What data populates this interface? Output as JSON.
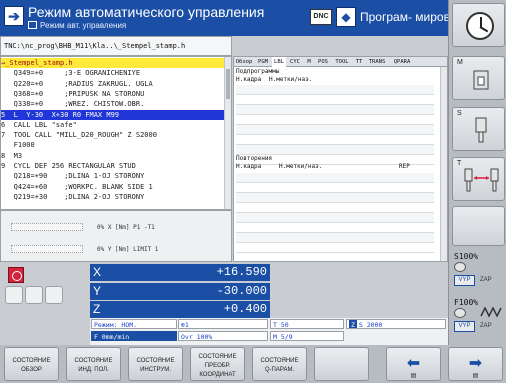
{
  "header": {
    "mode_icon": "machine-mode-icon",
    "mode_title": "Режим автоматического управления",
    "mode_sub": "Режим авт. управления",
    "dnc": "DNC",
    "prog_title": "Програм- мирован…"
  },
  "program": {
    "path": "TNC:\\nc_prog\\BHB_M11\\Kla..\\_Stempel_stamp.h",
    "lines": [
      {
        "text": "→_Stempel_stamp.h",
        "style": "cur"
      },
      {
        "text": "   Q349=+0     ;3-E OGRANICHENIYE",
        "style": ""
      },
      {
        "text": "   Q220=+0     ;RADIUS ZAKRUGL. UGLA",
        "style": ""
      },
      {
        "text": "   Q368=+0     ;PRIPUSK NA STORONU",
        "style": ""
      },
      {
        "text": "   Q338=+0     ;WREZ. CHISTOW.OBR.",
        "style": ""
      },
      {
        "text": "5  L  Y-30  X+30 R0 FMAX M99",
        "style": "sel"
      },
      {
        "text": "6  CALL LBL \"safe\"",
        "style": ""
      },
      {
        "text": "7  TOOL CALL \"MILL_D20_ROUGH\" Z S2000",
        "style": ""
      },
      {
        "text": "   F1000",
        "style": ""
      },
      {
        "text": "8  M3",
        "style": ""
      },
      {
        "text": "9  CYCL DEF 256 RECTANGULAR STUD",
        "style": ""
      },
      {
        "text": "   Q218=+90    ;DLINA 1-OJ STORONY",
        "style": ""
      },
      {
        "text": "   Q424=+60    ;WORKPC. BLANK SIDE 1",
        "style": ""
      },
      {
        "text": "   Q219=+30    ;DLINA 2-OJ STORONY",
        "style": ""
      }
    ]
  },
  "status_small": {
    "row1": "0% X [Nm]  P1  -T1",
    "row2": "0% Y [Nm]  LIMIT 1"
  },
  "tabs": {
    "items": [
      "Обзор",
      "PGM",
      "LBL",
      "CYC",
      "M",
      "POS",
      "TOOL",
      "TT",
      "TRANS",
      "QPARA"
    ],
    "active": "LBL",
    "sub_title": "Подпрограммы",
    "sub_cols": [
      "Н.кадра",
      "Н.метки/наз."
    ],
    "rep_title": "Повторения",
    "rep_cols": [
      "Н.кадра",
      "Н.метки/наз.",
      "REP"
    ]
  },
  "position": {
    "axes": [
      {
        "axis": "X",
        "value": "+16.590"
      },
      {
        "axis": "Y",
        "value": "-30.000"
      },
      {
        "axis": "Z",
        "value": "+0.400"
      }
    ],
    "mode": "Режим: НОМ.",
    "feed": "F 0mm/min",
    "spindle_ref": "1",
    "ovr": "Ovr 100%",
    "tool": "T 50",
    "speed": "S 2000",
    "mfunc": "M 5/9",
    "z_tag": "Z"
  },
  "right_keys": {
    "m": "M",
    "s": "S",
    "t": "T",
    "s_ovr": "S100%",
    "f_ovr": "F100%",
    "vyp": "VYP",
    "zap": "ZAP"
  },
  "softkeys": [
    {
      "l1": "СОСТОЯНИЕ",
      "l2": "ОБЗОР"
    },
    {
      "l1": "СОСТОЯНИЕ",
      "l2": "ИНД. ПОЛ."
    },
    {
      "l1": "СОСТОЯНИЕ",
      "l2": "ИНСТРУМ."
    },
    {
      "l1": "СОСТОЯНИЕ",
      "l2": "ПРЕОБР.",
      "l3": "КООРДИНАТ"
    },
    {
      "l1": "СОСТОЯНИЕ",
      "l2": "Q-ПАРАМ."
    }
  ]
}
